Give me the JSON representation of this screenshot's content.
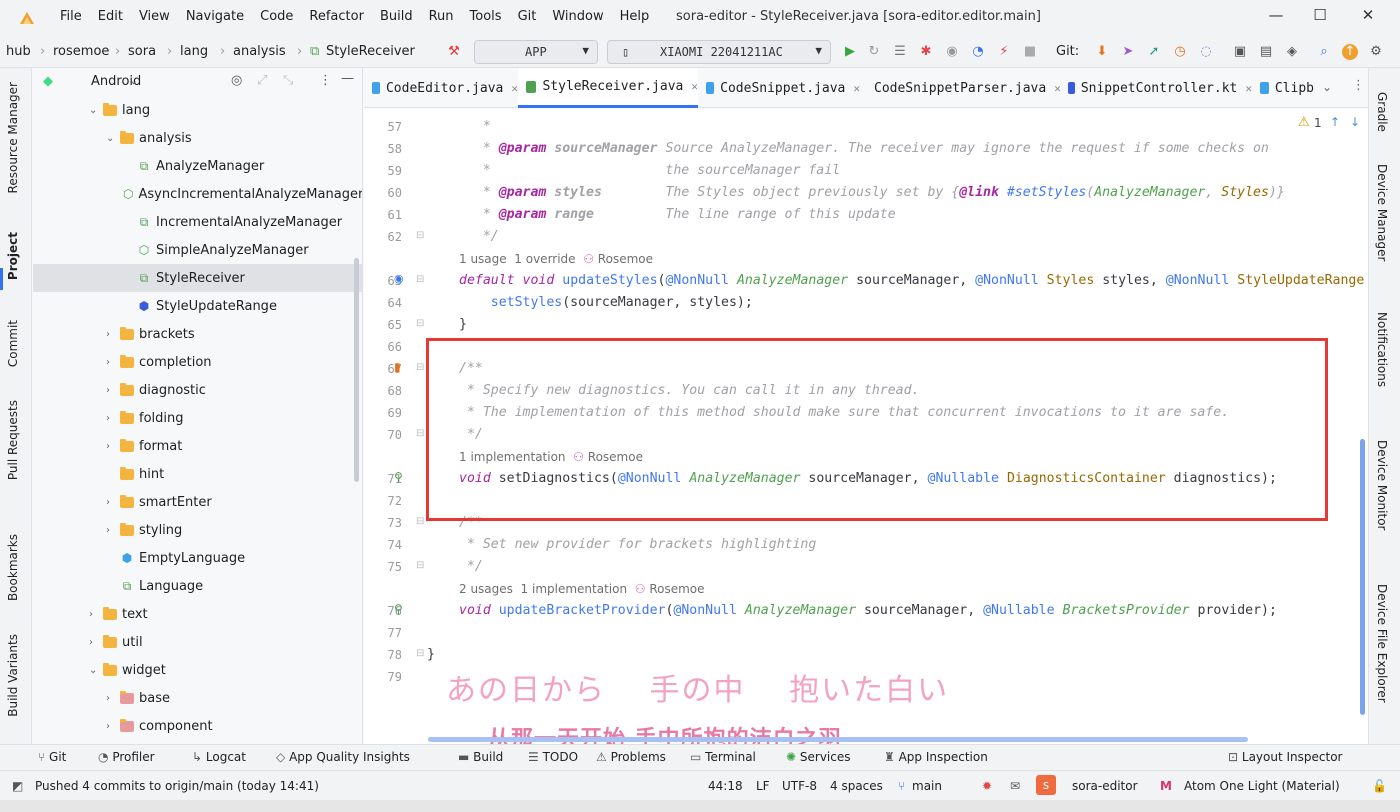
{
  "window": {
    "title": "sora-editor - StyleReceiver.java [sora-editor.editor.main]",
    "menu": [
      "File",
      "Edit",
      "View",
      "Navigate",
      "Code",
      "Refactor",
      "Build",
      "Run",
      "Tools",
      "Git",
      "Window",
      "Help"
    ]
  },
  "breadcrumbs": [
    "hub",
    "rosemoe",
    "sora",
    "lang",
    "analysis",
    "StyleReceiver"
  ],
  "toolbar": {
    "run_config": "APP",
    "device": "XIAOMI 22041211AC",
    "git_label": "Git:"
  },
  "left_strip": [
    "Resource Manager",
    "Project",
    "Commit",
    "Pull Requests",
    "Bookmarks",
    "Build Variants"
  ],
  "project": {
    "view_selector": "Android",
    "items": [
      {
        "label": "lang",
        "kind": "folder",
        "indent": 0,
        "expanded": true
      },
      {
        "label": "analysis",
        "kind": "folder",
        "indent": 1,
        "expanded": true
      },
      {
        "label": "AnalyzeManager",
        "kind": "interface",
        "indent": 2
      },
      {
        "label": "AsyncIncrementalAnalyzeManager",
        "kind": "abstract",
        "indent": 2
      },
      {
        "label": "IncrementalAnalyzeManager",
        "kind": "interface",
        "indent": 2
      },
      {
        "label": "SimpleAnalyzeManager",
        "kind": "abstract",
        "indent": 2
      },
      {
        "label": "StyleReceiver",
        "kind": "interface",
        "indent": 2,
        "selected": true
      },
      {
        "label": "StyleUpdateRange",
        "kind": "class",
        "indent": 2
      },
      {
        "label": "brackets",
        "kind": "folder",
        "indent": 1
      },
      {
        "label": "completion",
        "kind": "folder",
        "indent": 1
      },
      {
        "label": "diagnostic",
        "kind": "folder",
        "indent": 1
      },
      {
        "label": "folding",
        "kind": "folder",
        "indent": 1
      },
      {
        "label": "format",
        "kind": "folder",
        "indent": 1
      },
      {
        "label": "hint",
        "kind": "folder-plain",
        "indent": 1
      },
      {
        "label": "smartEnter",
        "kind": "folder",
        "indent": 1
      },
      {
        "label": "styling",
        "kind": "folder",
        "indent": 1
      },
      {
        "label": "EmptyLanguage",
        "kind": "class-blue",
        "indent": 1
      },
      {
        "label": "Language",
        "kind": "interface",
        "indent": 1
      },
      {
        "label": "text",
        "kind": "folder",
        "indent": 0
      },
      {
        "label": "util",
        "kind": "folder",
        "indent": 0
      },
      {
        "label": "widget",
        "kind": "folder",
        "indent": 0,
        "expanded": true
      },
      {
        "label": "base",
        "kind": "folder-pink",
        "indent": 1
      },
      {
        "label": "component",
        "kind": "folder-pink",
        "indent": 1
      }
    ]
  },
  "tabs": [
    "CodeEditor.java",
    "StyleReceiver.java",
    "CodeSnippet.java",
    "CodeSnippetParser.java",
    "SnippetController.kt",
    "Clipb"
  ],
  "editor": {
    "warning_count": "1",
    "lines": {
      "l57": "57",
      "l58": "58",
      "l59": "59",
      "l60": "60",
      "l61": "61",
      "l62": "62",
      "l63": "63",
      "l64": "64",
      "l65": "65",
      "l66": "66",
      "l67": "67",
      "l68": "68",
      "l69": "69",
      "l70": "70",
      "l71": "71",
      "l72": "72",
      "l73": "73",
      "l74": "74",
      "l75": "75",
      "l76": "76",
      "l77": "77",
      "l78": "78",
      "l79": "79"
    },
    "hints": {
      "h1": "1 usage  1 override",
      "h1_author": "Rosemoe",
      "h2": "1 implementation",
      "h2_author": "Rosemoe",
      "h3": "2 usages  1 implementation",
      "h3_author": "Rosemoe"
    }
  },
  "lyrics": {
    "japanese": "あの日から　 手の中　 抱いた白い",
    "chinese": "从那一天开始 手中所抱的洁白之羽"
  },
  "right_strip": [
    "Gradle",
    "Device Manager",
    "Notifications",
    "Device Monitor",
    "Device File Explorer"
  ],
  "toolwindows": [
    "Git",
    "Profiler",
    "Logcat",
    "App Quality Insights",
    "Build",
    "TODO",
    "Problems",
    "Terminal",
    "Services",
    "App Inspection",
    "Layout Inspector"
  ],
  "status": {
    "message": "Pushed 4 commits to origin/main (today 14:41)",
    "position": "44:18",
    "line_sep": "LF",
    "encoding": "UTF-8",
    "indent": "4 spaces",
    "branch": "main",
    "project": "sora-editor",
    "theme": "Atom One Light (Material)"
  },
  "colors": {
    "accent": "#3574f0",
    "highlight_box": "#e53935",
    "lyric": "#f06292"
  }
}
